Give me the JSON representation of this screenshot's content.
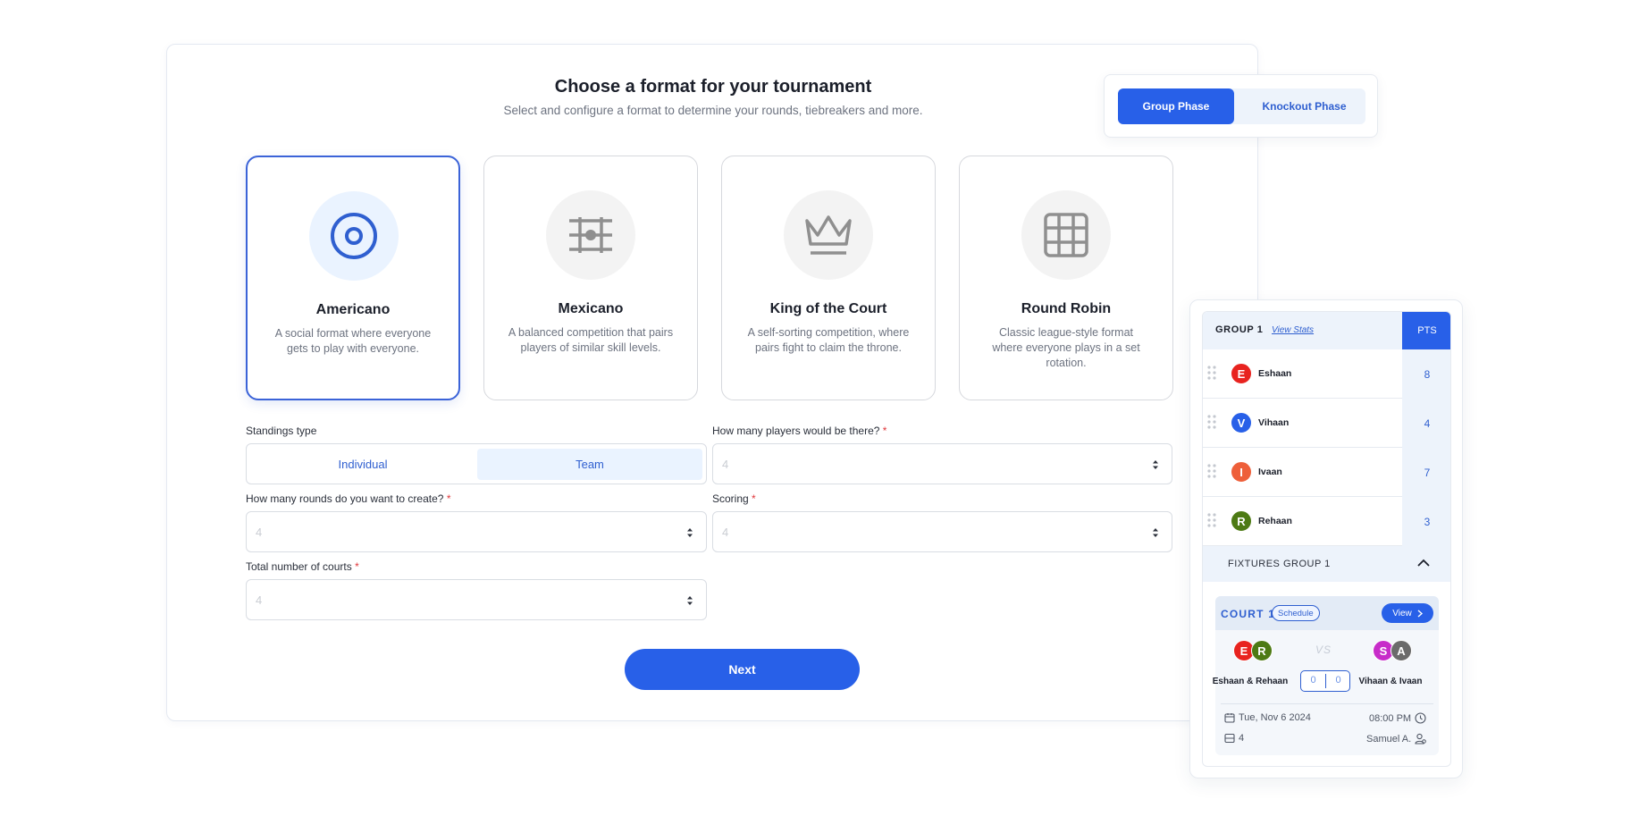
{
  "header": {
    "title": "Choose a format for your tournament",
    "subtitle": "Select and configure a format to determine your rounds, tiebreakers and more."
  },
  "formats": [
    {
      "title": "Americano",
      "description": "A social format where everyone gets to play with everyone.",
      "icon": "target-icon",
      "selected": true
    },
    {
      "title": "Mexicano",
      "description": "A balanced competition that pairs players of similar skill levels.",
      "icon": "court-net-icon",
      "selected": false
    },
    {
      "title": "King of the Court",
      "description": "A self-sorting competition, where pairs fight to claim the throne.",
      "icon": "crown-icon",
      "selected": false
    },
    {
      "title": "Round Robin",
      "description": "Classic league-style format where everyone plays in a set rotation.",
      "icon": "grid-icon",
      "selected": false
    }
  ],
  "form": {
    "standings_label": "Standings type",
    "standings_options": [
      "Individual",
      "Team"
    ],
    "standings_selected": "Team",
    "players_label": "How many players would be there?",
    "players_value": "4",
    "rounds_label": "How many rounds do you want to create?",
    "rounds_value": "4",
    "scoring_label": "Scoring",
    "scoring_value": "4",
    "courts_label": "Total number of courts",
    "courts_value": "4",
    "required_mark": "*",
    "next_label": "Next"
  },
  "phases": {
    "active": "Group Phase",
    "items": [
      "Group Phase",
      "Knockout Phase"
    ]
  },
  "standings": {
    "group_title": "GROUP 1",
    "view_stats": "View Stats",
    "pts_label": "PTS",
    "players": [
      {
        "initial": "E",
        "name": "Eshaan",
        "pts": "8",
        "color": "#e8231f"
      },
      {
        "initial": "V",
        "name": "Vihaan",
        "pts": "4",
        "color": "#2860e8"
      },
      {
        "initial": "I",
        "name": "Ivaan",
        "pts": "7",
        "color": "#ee5f3a"
      },
      {
        "initial": "R",
        "name": "Rehaan",
        "pts": "3",
        "color": "#4d7a14"
      }
    ],
    "fixtures_title": "FIXTURES GROUP 1",
    "fixture": {
      "court": "COURT 1",
      "schedule_chip": "Schedule",
      "view_label": "View",
      "vs": "VS",
      "team_a": {
        "name": "Eshaan & Rehaan",
        "initials": [
          "E",
          "R"
        ],
        "colors": [
          "#e8231f",
          "#4d7a14"
        ]
      },
      "team_b": {
        "name": "Vihaan & Ivaan",
        "initials": [
          "S",
          "A"
        ],
        "colors": [
          "#c72cc9",
          "#6b6b6b"
        ]
      },
      "score_a": "0",
      "score_b": "0",
      "date": "Tue, Nov 6 2024",
      "time": "08:00 PM",
      "court_number": "4",
      "referee": "Samuel A."
    }
  }
}
